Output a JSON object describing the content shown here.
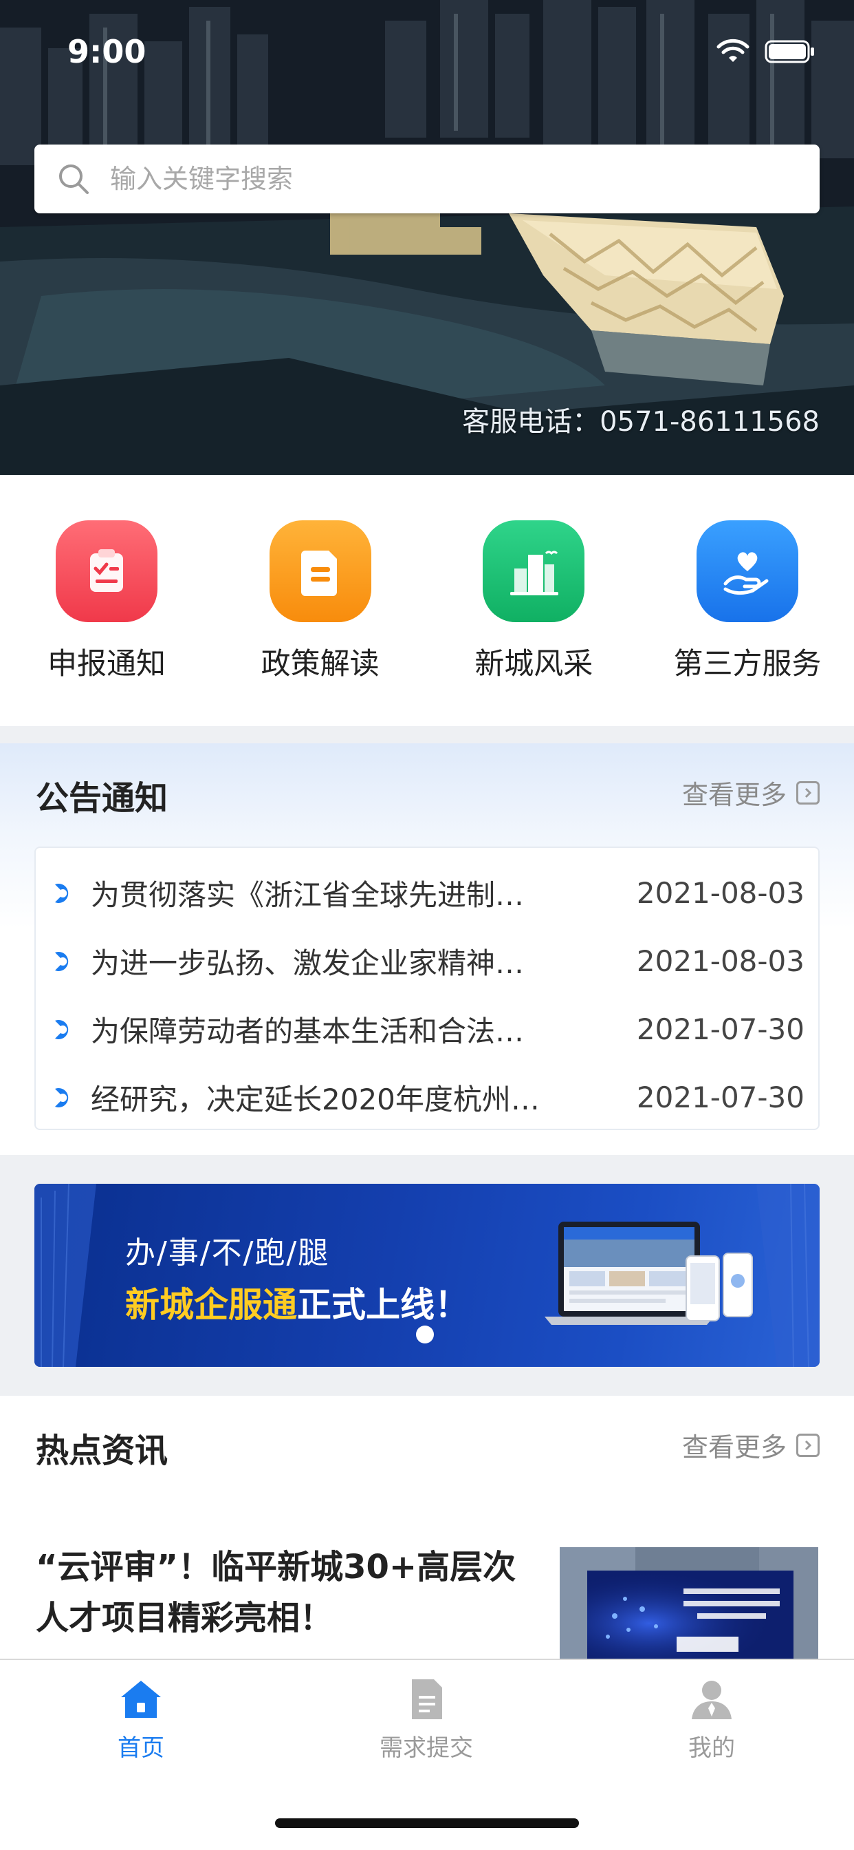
{
  "status_bar": {
    "time": "9:00"
  },
  "search": {
    "placeholder": "输入关键字搜索"
  },
  "hero": {
    "hotline": "客服电话：0571-86111568"
  },
  "quick_nav": [
    {
      "label": "申报通知",
      "icon": "clipboard-icon",
      "color": "#f34b5a"
    },
    {
      "label": "政策解读",
      "icon": "document-icon",
      "color": "#fb9b18"
    },
    {
      "label": "新城风采",
      "icon": "city-icon",
      "color": "#1bbf72"
    },
    {
      "label": "第三方服务",
      "icon": "heart-hand-icon",
      "color": "#2a86f6"
    }
  ],
  "notices": {
    "title": "公告通知",
    "more": "查看更多",
    "items": [
      {
        "title": "为贯彻落实《浙江省全球先进制…",
        "date": "2021-08-03"
      },
      {
        "title": "为进一步弘扬、激发企业家精神…",
        "date": "2021-08-03"
      },
      {
        "title": "为保障劳动者的基本生活和合法…",
        "date": "2021-07-30"
      },
      {
        "title": "经研究，决定延长2020年度杭州…",
        "date": "2021-07-30"
      }
    ]
  },
  "banner": {
    "line1": "办/事/不/跑/腿",
    "line2_highlight": "新城企服通",
    "line2_rest": "正式上线！"
  },
  "hot_news": {
    "title": "热点资讯",
    "more": "查看更多",
    "first_item": {
      "title": "“云评审”！临平新城30+高层次人才项目精彩亮相！"
    }
  },
  "tabbar": {
    "tabs": [
      {
        "label": "首页",
        "icon": "home-icon",
        "active": true
      },
      {
        "label": "需求提交",
        "icon": "document-icon",
        "active": false
      },
      {
        "label": "我的",
        "icon": "user-icon",
        "active": false
      }
    ]
  },
  "colors": {
    "accent": "#1a7cf0",
    "inactive": "#9a9a9a",
    "highlight": "#ffcc22"
  }
}
